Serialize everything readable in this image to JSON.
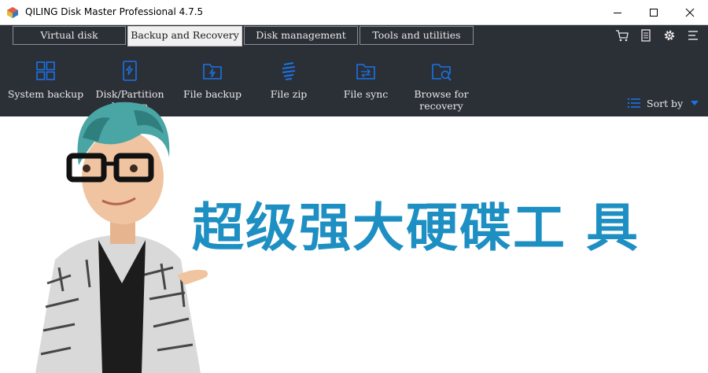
{
  "window": {
    "title": "QILING Disk Master Professional 4.7.5",
    "controls": [
      "minimize",
      "maximize",
      "close"
    ]
  },
  "tabs": [
    {
      "label": "Virtual disk",
      "active": false
    },
    {
      "label": "Backup and Recovery",
      "active": true
    },
    {
      "label": "Disk management",
      "active": false
    },
    {
      "label": "Tools and utilities",
      "active": false
    }
  ],
  "header_icons": [
    "cart-icon",
    "document-icon",
    "gear-icon",
    "menu-icon"
  ],
  "toolbar": {
    "items": [
      {
        "label": "System backup",
        "icon": "windows-icon"
      },
      {
        "label": "Disk/Partition backup",
        "icon": "disk-backup-icon"
      },
      {
        "label": "File backup",
        "icon": "folder-backup-icon"
      },
      {
        "label": "File zip",
        "icon": "zip-icon"
      },
      {
        "label": "File sync",
        "icon": "folder-sync-icon"
      },
      {
        "label": "Browse for recovery",
        "icon": "browse-recovery-icon"
      }
    ],
    "sort_label": "Sort by"
  },
  "banner": {
    "text": "超级强大硬碟工 具"
  },
  "colors": {
    "accent": "#1a73e8",
    "dark_bg": "#2b2f36",
    "banner": "#1e8fc2"
  }
}
